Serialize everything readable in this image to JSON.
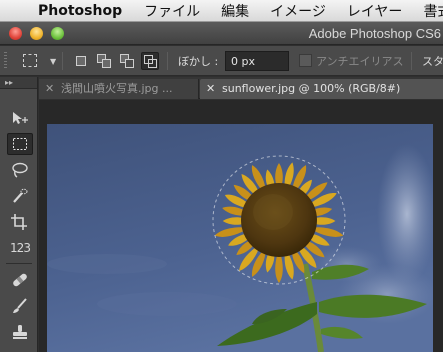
{
  "menubar": {
    "app_name": "Photoshop",
    "items": [
      "ファイル",
      "編集",
      "イメージ",
      "レイヤー",
      "書式"
    ]
  },
  "window": {
    "title": "Adobe Photoshop CS6"
  },
  "options": {
    "feather_label": "ぼかし :",
    "feather_value": "0 px",
    "antialias_label": "アンチエイリアス",
    "style_label": "スタ"
  },
  "tabs": [
    {
      "label": "浅間山噴火写真.jpg ...",
      "active": false
    },
    {
      "label": "sunflower.jpg @ 100% (RGB/8#)",
      "active": true
    }
  ],
  "tools": {
    "number_tool_label": "123"
  },
  "colors": {
    "sky": "#4a5f8c",
    "petal": "#d9a820",
    "leaf": "#3c6a1e"
  }
}
